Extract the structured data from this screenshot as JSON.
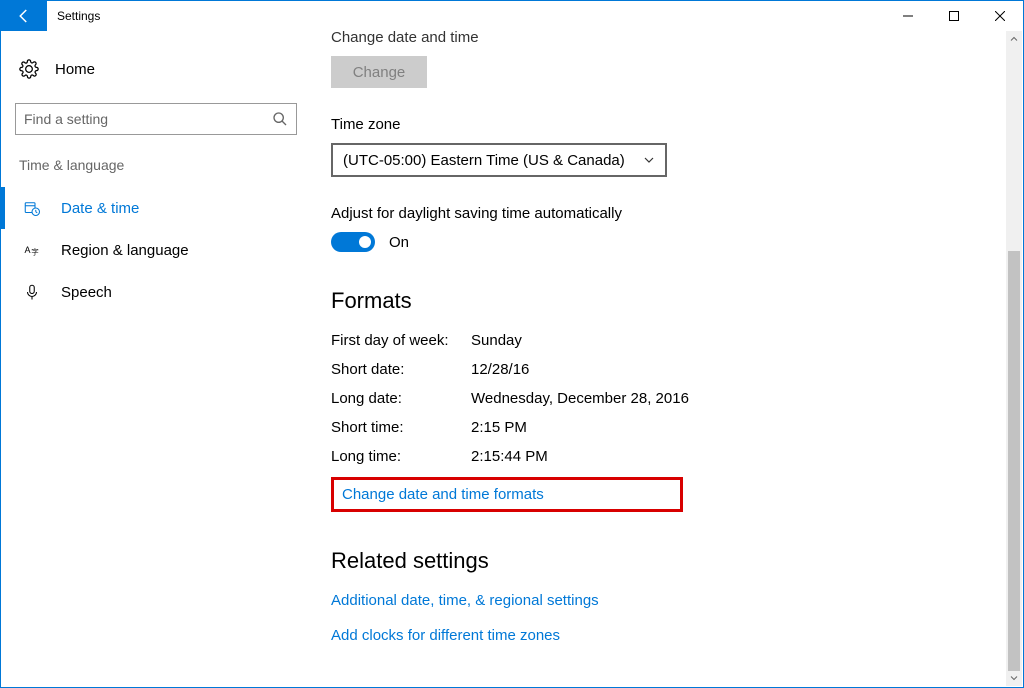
{
  "window": {
    "title": "Settings"
  },
  "sidebar": {
    "home_label": "Home",
    "search_placeholder": "Find a setting",
    "category_label": "Time & language",
    "items": [
      {
        "label": "Date & time"
      },
      {
        "label": "Region & language"
      },
      {
        "label": "Speech"
      }
    ]
  },
  "content": {
    "change_dt_label": "Change date and time",
    "change_btn": "Change",
    "timezone_label": "Time zone",
    "timezone_value": "(UTC-05:00) Eastern Time (US & Canada)",
    "dst_label": "Adjust for daylight saving time automatically",
    "dst_state": "On",
    "formats_heading": "Formats",
    "kv": [
      {
        "k": "First day of week:",
        "v": "Sunday"
      },
      {
        "k": "Short date:",
        "v": "12/28/16"
      },
      {
        "k": "Long date:",
        "v": "Wednesday, December 28, 2016"
      },
      {
        "k": "Short time:",
        "v": "2:15 PM"
      },
      {
        "k": "Long time:",
        "v": "2:15:44 PM"
      }
    ],
    "change_formats_link": "Change date and time formats",
    "related_heading": "Related settings",
    "related_links": [
      "Additional date, time, & regional settings",
      "Add clocks for different time zones"
    ]
  }
}
